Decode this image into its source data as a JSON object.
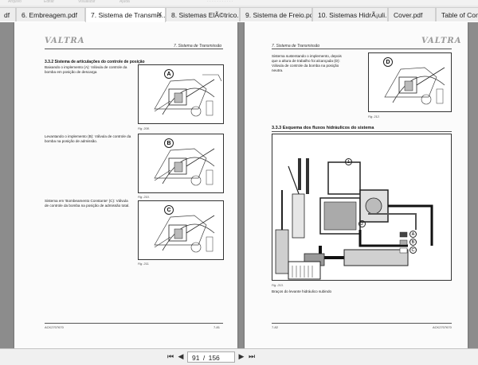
{
  "tabs": [
    {
      "label": "df"
    },
    {
      "label": "6. Embreagem.pdf"
    },
    {
      "label": "7. Sistema de Transmis..."
    },
    {
      "label": "8. Sistemas ElÃ©trico..."
    },
    {
      "label": "9. Sistema de Freio.pdf"
    },
    {
      "label": "10. Sistemas HidrÃ¡uli..."
    },
    {
      "label": "Cover.pdf"
    },
    {
      "label": "Table of Conte..."
    }
  ],
  "left_page": {
    "logo": "VALTRA",
    "header_title": "7. Sistema de Transmissão",
    "section_title": "3.3.2  Sistema de articulações do controle de posição",
    "paragraphs": [
      "Baixando o implemento (A): Válvula de controle da bomba em posição de descarga",
      "Levantando o implemento (B): Válvula de controle da bomba na posição de admissão.",
      "Sistema em 'Bombeamento Constante' (C): Válvula de controle da bomba na posição de admissão total."
    ],
    "fig_letters": [
      "A",
      "B",
      "C"
    ],
    "fig_captions": [
      "Fig. 208.",
      "Fig. 210.",
      "Fig. 211."
    ],
    "footer_left": "ACK2707670",
    "footer_right": "7-81"
  },
  "right_page": {
    "logo": "VALTRA",
    "header_title": "7. Sistema de Transmissão",
    "paragraph": "Sistema sustentando o implemento, depois que a altura de trabalho foi alcançada (D): Válvula de controle da bomba na posição neutra.",
    "fig_letter_d": "D",
    "fig_caption_d": "Fig. 212.",
    "section_title": "3.3.3  Esquema dos fluxos hidráulicos do sistema",
    "diagram_labels": [
      "1",
      "2",
      "A",
      "B",
      "C"
    ],
    "diagram_caption": "Fig. 213.",
    "diagram_text": "Braços do levante hidráulico subindo",
    "footer_left": "7-82",
    "footer_right": "ACK2707670"
  },
  "nav": {
    "current_page": "91",
    "separator": "/",
    "total_pages": "156"
  }
}
